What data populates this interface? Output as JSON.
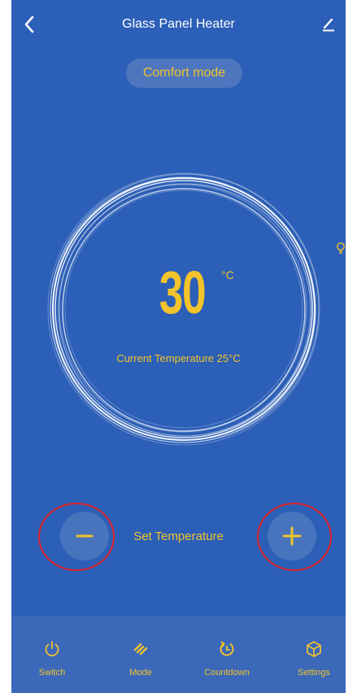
{
  "header": {
    "title": "Glass Panel Heater"
  },
  "mode_pill": {
    "label": "Comfort mode"
  },
  "dial": {
    "set_temperature": "30",
    "unit": "°C",
    "current_temperature_text": "Current Temperature 25°C"
  },
  "controls": {
    "set_label": "Set Temperature"
  },
  "tabs": [
    {
      "label": "Switch",
      "icon": "power-icon"
    },
    {
      "label": "Mode",
      "icon": "mode-icon"
    },
    {
      "label": "Countdown",
      "icon": "countdown-icon"
    },
    {
      "label": "Settings",
      "icon": "settings-icon"
    }
  ],
  "colors": {
    "background": "#2c5fb7",
    "accent": "#f2c32a",
    "highlight_circle": "#e0262a"
  }
}
